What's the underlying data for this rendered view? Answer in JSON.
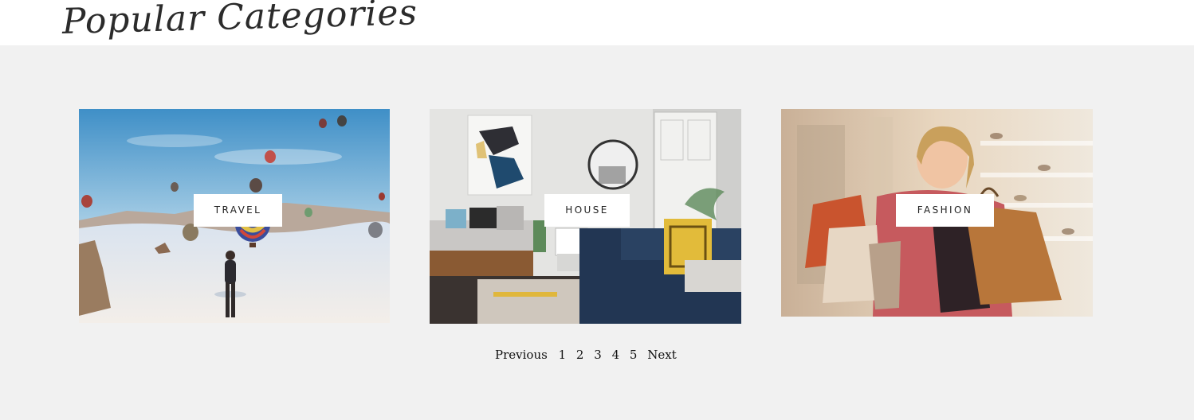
{
  "section": {
    "title": "Popular Categories"
  },
  "cards": [
    {
      "label": "TRAVEL",
      "image": "travel-photo"
    },
    {
      "label": "HOUSE",
      "image": "house-photo"
    },
    {
      "label": "FASHION",
      "image": "fashion-photo"
    }
  ],
  "pagination": {
    "previous": "Previous",
    "pages": [
      "1",
      "2",
      "3",
      "4",
      "5"
    ],
    "next": "Next"
  },
  "colors": {
    "band": "#f1f1f1",
    "label_bg": "#ffffff"
  }
}
